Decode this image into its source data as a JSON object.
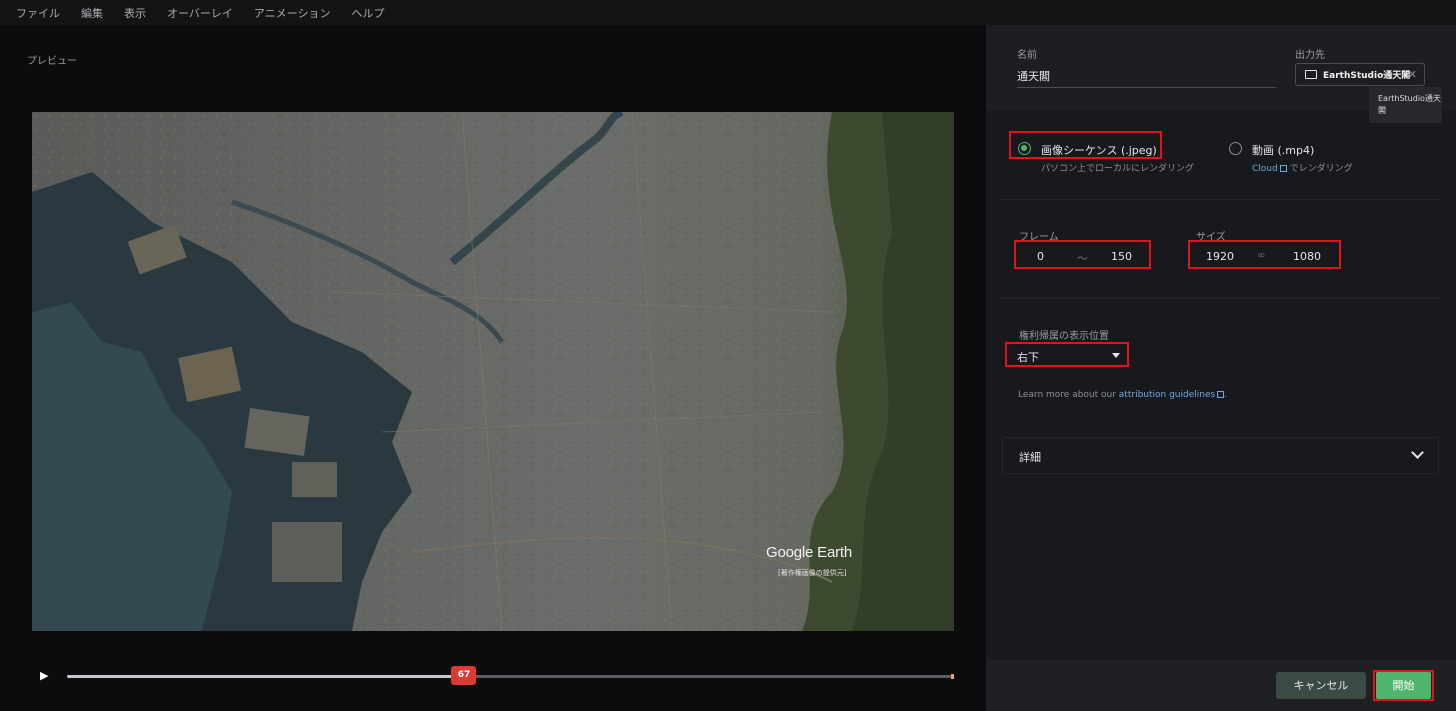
{
  "menubar": {
    "items": [
      "ファイル",
      "編集",
      "表示",
      "オーバーレイ",
      "アニメーション",
      "ヘルプ"
    ]
  },
  "preview": {
    "label": "プレビュー",
    "logo": "Google Earth",
    "credit": "[著作権画像の提供元]"
  },
  "timeline": {
    "play_icon": "▶",
    "current_frame": "67",
    "progress": 0.447
  },
  "output": {
    "name_label": "名前",
    "name_value": "通天閣",
    "dest_label": "出力先",
    "dest_value": "EarthStudio通天閣",
    "tooltip": "EarthStudio通天閣"
  },
  "format": {
    "image_title": "画像シーケンス (.jpeg)",
    "image_sub": "パソコン上でローカルにレンダリング",
    "video_title": "動画 (.mp4)",
    "video_sub_link": "Cloud",
    "video_sub_rest": " でレンダリング"
  },
  "frames": {
    "label": "フレーム",
    "start": "0",
    "separator": "～",
    "end": "150"
  },
  "size": {
    "label": "サイズ",
    "width": "1920",
    "link_icon": "∞",
    "height": "1080"
  },
  "attribution": {
    "label": "権利帰属の表示位置",
    "value": "右下",
    "note_prefix": "Learn more about our ",
    "note_link": "attribution guidelines",
    "note_suffix": "."
  },
  "details": {
    "label": "詳細"
  },
  "footer": {
    "cancel": "キャンセル",
    "start": "開始"
  },
  "colors": {
    "accent_green": "#4fb56c",
    "handle_red": "#dd3b31",
    "highlight_red": "#e0141c",
    "link_blue": "#6ea8e6"
  }
}
